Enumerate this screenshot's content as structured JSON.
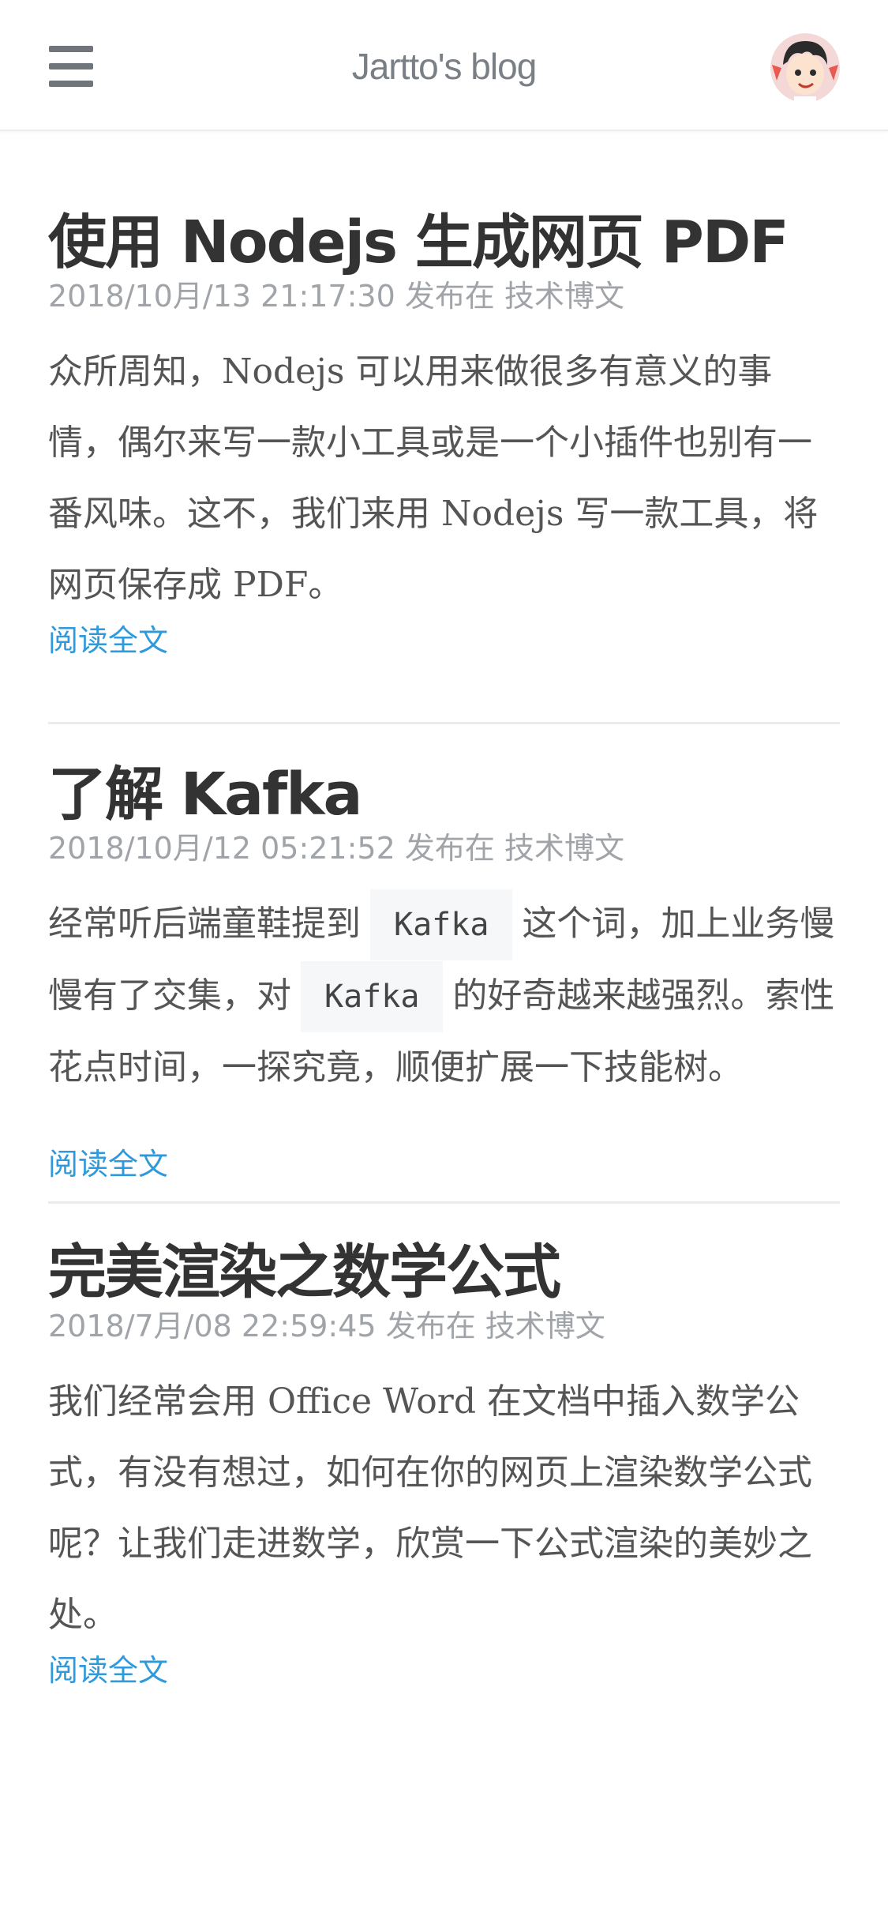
{
  "header": {
    "title": "Jartto's blog",
    "menu_icon": "hamburger-menu-icon",
    "avatar_icon": "avatar-cartoon-icon"
  },
  "posts": [
    {
      "title": "使用 Nodejs 生成网页 PDF",
      "date": "2018/10月/13 21:17:30",
      "published_in": "发布在",
      "category": "技术博文",
      "excerpt": "众所周知，Nodejs 可以用来做很多有意义的事情，偶尔来写一款小工具或是一个小插件也别有一番风味。这不，我们来用 Nodejs 写一款工具，将网页保存成 PDF。",
      "read_more": "阅读全文"
    },
    {
      "title": "了解 Kafka",
      "date": "2018/10月/12 05:21:52",
      "published_in": "发布在",
      "category": "技术博文",
      "excerpt_a": "经常听后端童鞋提到",
      "code_1": "Kafka",
      "excerpt_b": "这个词，加上业务慢慢有了交集，对",
      "code_2": "Kafka",
      "excerpt_c": "的好奇越来越强烈。索性花点时间，一探究竟，顺便扩展一下技能树。",
      "read_more": "阅读全文"
    },
    {
      "title": "完美渲染之数学公式",
      "date": "2018/7月/08 22:59:45",
      "published_in": "发布在",
      "category": "技术博文",
      "excerpt": "我们经常会用 Office Word 在文档中插入数学公式，有没有想过，如何在你的网页上渲染数学公式呢？让我们走进数学，欣赏一下公式渲染的美妙之处。",
      "read_more": "阅读全文"
    }
  ],
  "colors": {
    "link": "#2f9adb",
    "meta": "#a0a4a8",
    "title": "#333333",
    "body": "#555555"
  }
}
